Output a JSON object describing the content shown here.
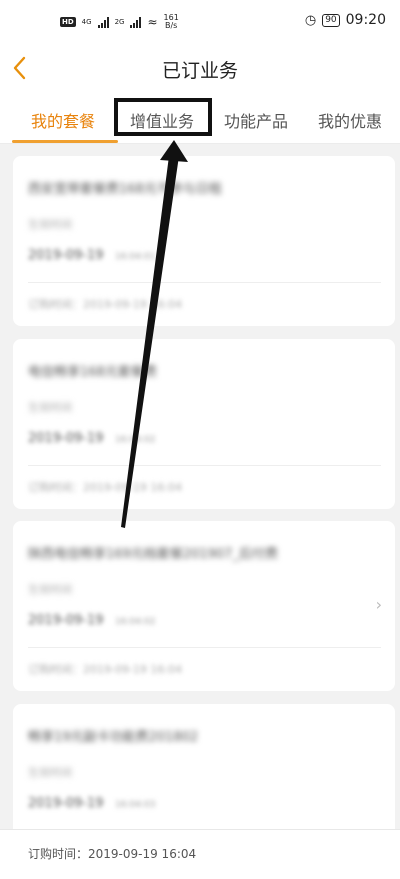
{
  "status_bar": {
    "hd_badge": "HD",
    "net1": "4G",
    "net2": "2G",
    "speed_value": "161",
    "speed_unit": "B/s",
    "battery": "90",
    "time": "09:20"
  },
  "header": {
    "title": "已订业务"
  },
  "tabs": [
    {
      "label": "我的套餐",
      "active": true
    },
    {
      "label": "增值业务",
      "active": false
    },
    {
      "label": "功能产品",
      "active": false
    },
    {
      "label": "我的优惠",
      "active": false
    }
  ],
  "subscriptions": [
    {
      "name": "西安宽带套餐费168元不参与日租",
      "label": "生效时间",
      "date": "2019-09-19",
      "time": "16:04:01",
      "order_time": "订购时间：2019-09-19 16:04"
    },
    {
      "name": "电信畅享168元套餐费",
      "label": "生效时间",
      "date": "2019-09-19",
      "time": "16:04:02",
      "order_time": "订购时间：2019-09-19 16:04"
    },
    {
      "name": "陕西电信畅享169元档套餐201907_后付费",
      "label": "生效时间",
      "date": "2019-09-19",
      "time": "16:04:02",
      "order_time": "订购时间：2019-09-19 16:04"
    },
    {
      "name": "畅享19元副卡功能费201802",
      "label": "生效时间",
      "date": "2019-09-19",
      "time": "16:04:03",
      "order_time": "订购时间：2019-09-19 16:04"
    }
  ],
  "icons": {
    "back": "chevron-left-icon",
    "chevron": "chevron-right-icon"
  },
  "colors": {
    "accent": "#e8830c",
    "underline": "#f0a030",
    "annotation": "#111111"
  }
}
